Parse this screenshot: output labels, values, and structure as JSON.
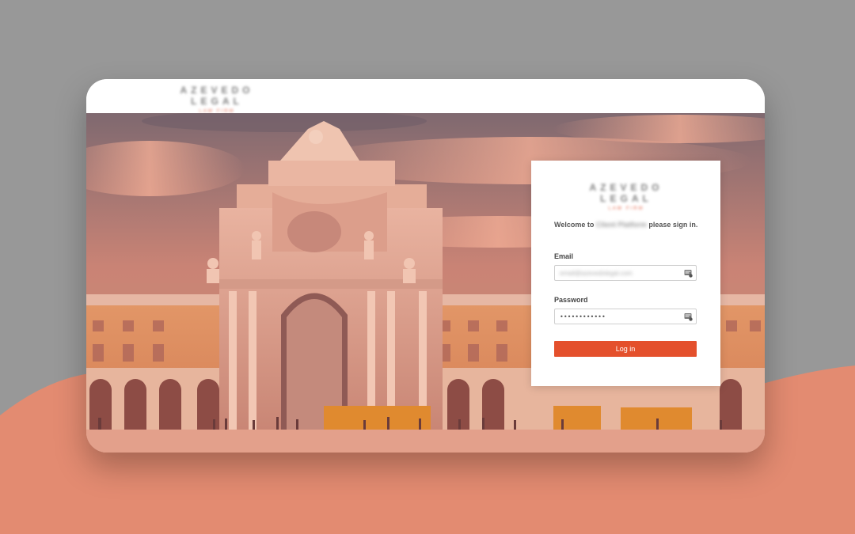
{
  "app": {
    "brand_name": "AZEVEDO LEGAL",
    "brand_tagline": "LAW FIRM"
  },
  "login": {
    "welcome_prefix": "Welcome to ",
    "welcome_product": "Client Platform",
    "welcome_suffix": " please sign in.",
    "email_label": "Email",
    "email_value": "email@azevedolegal.com",
    "password_label": "Password",
    "password_value": "••••••••••••",
    "submit_label": "Log in"
  },
  "colors": {
    "accent": "#e4502c",
    "background_grey": "#989898",
    "wave_salmon": "#e38b71"
  }
}
